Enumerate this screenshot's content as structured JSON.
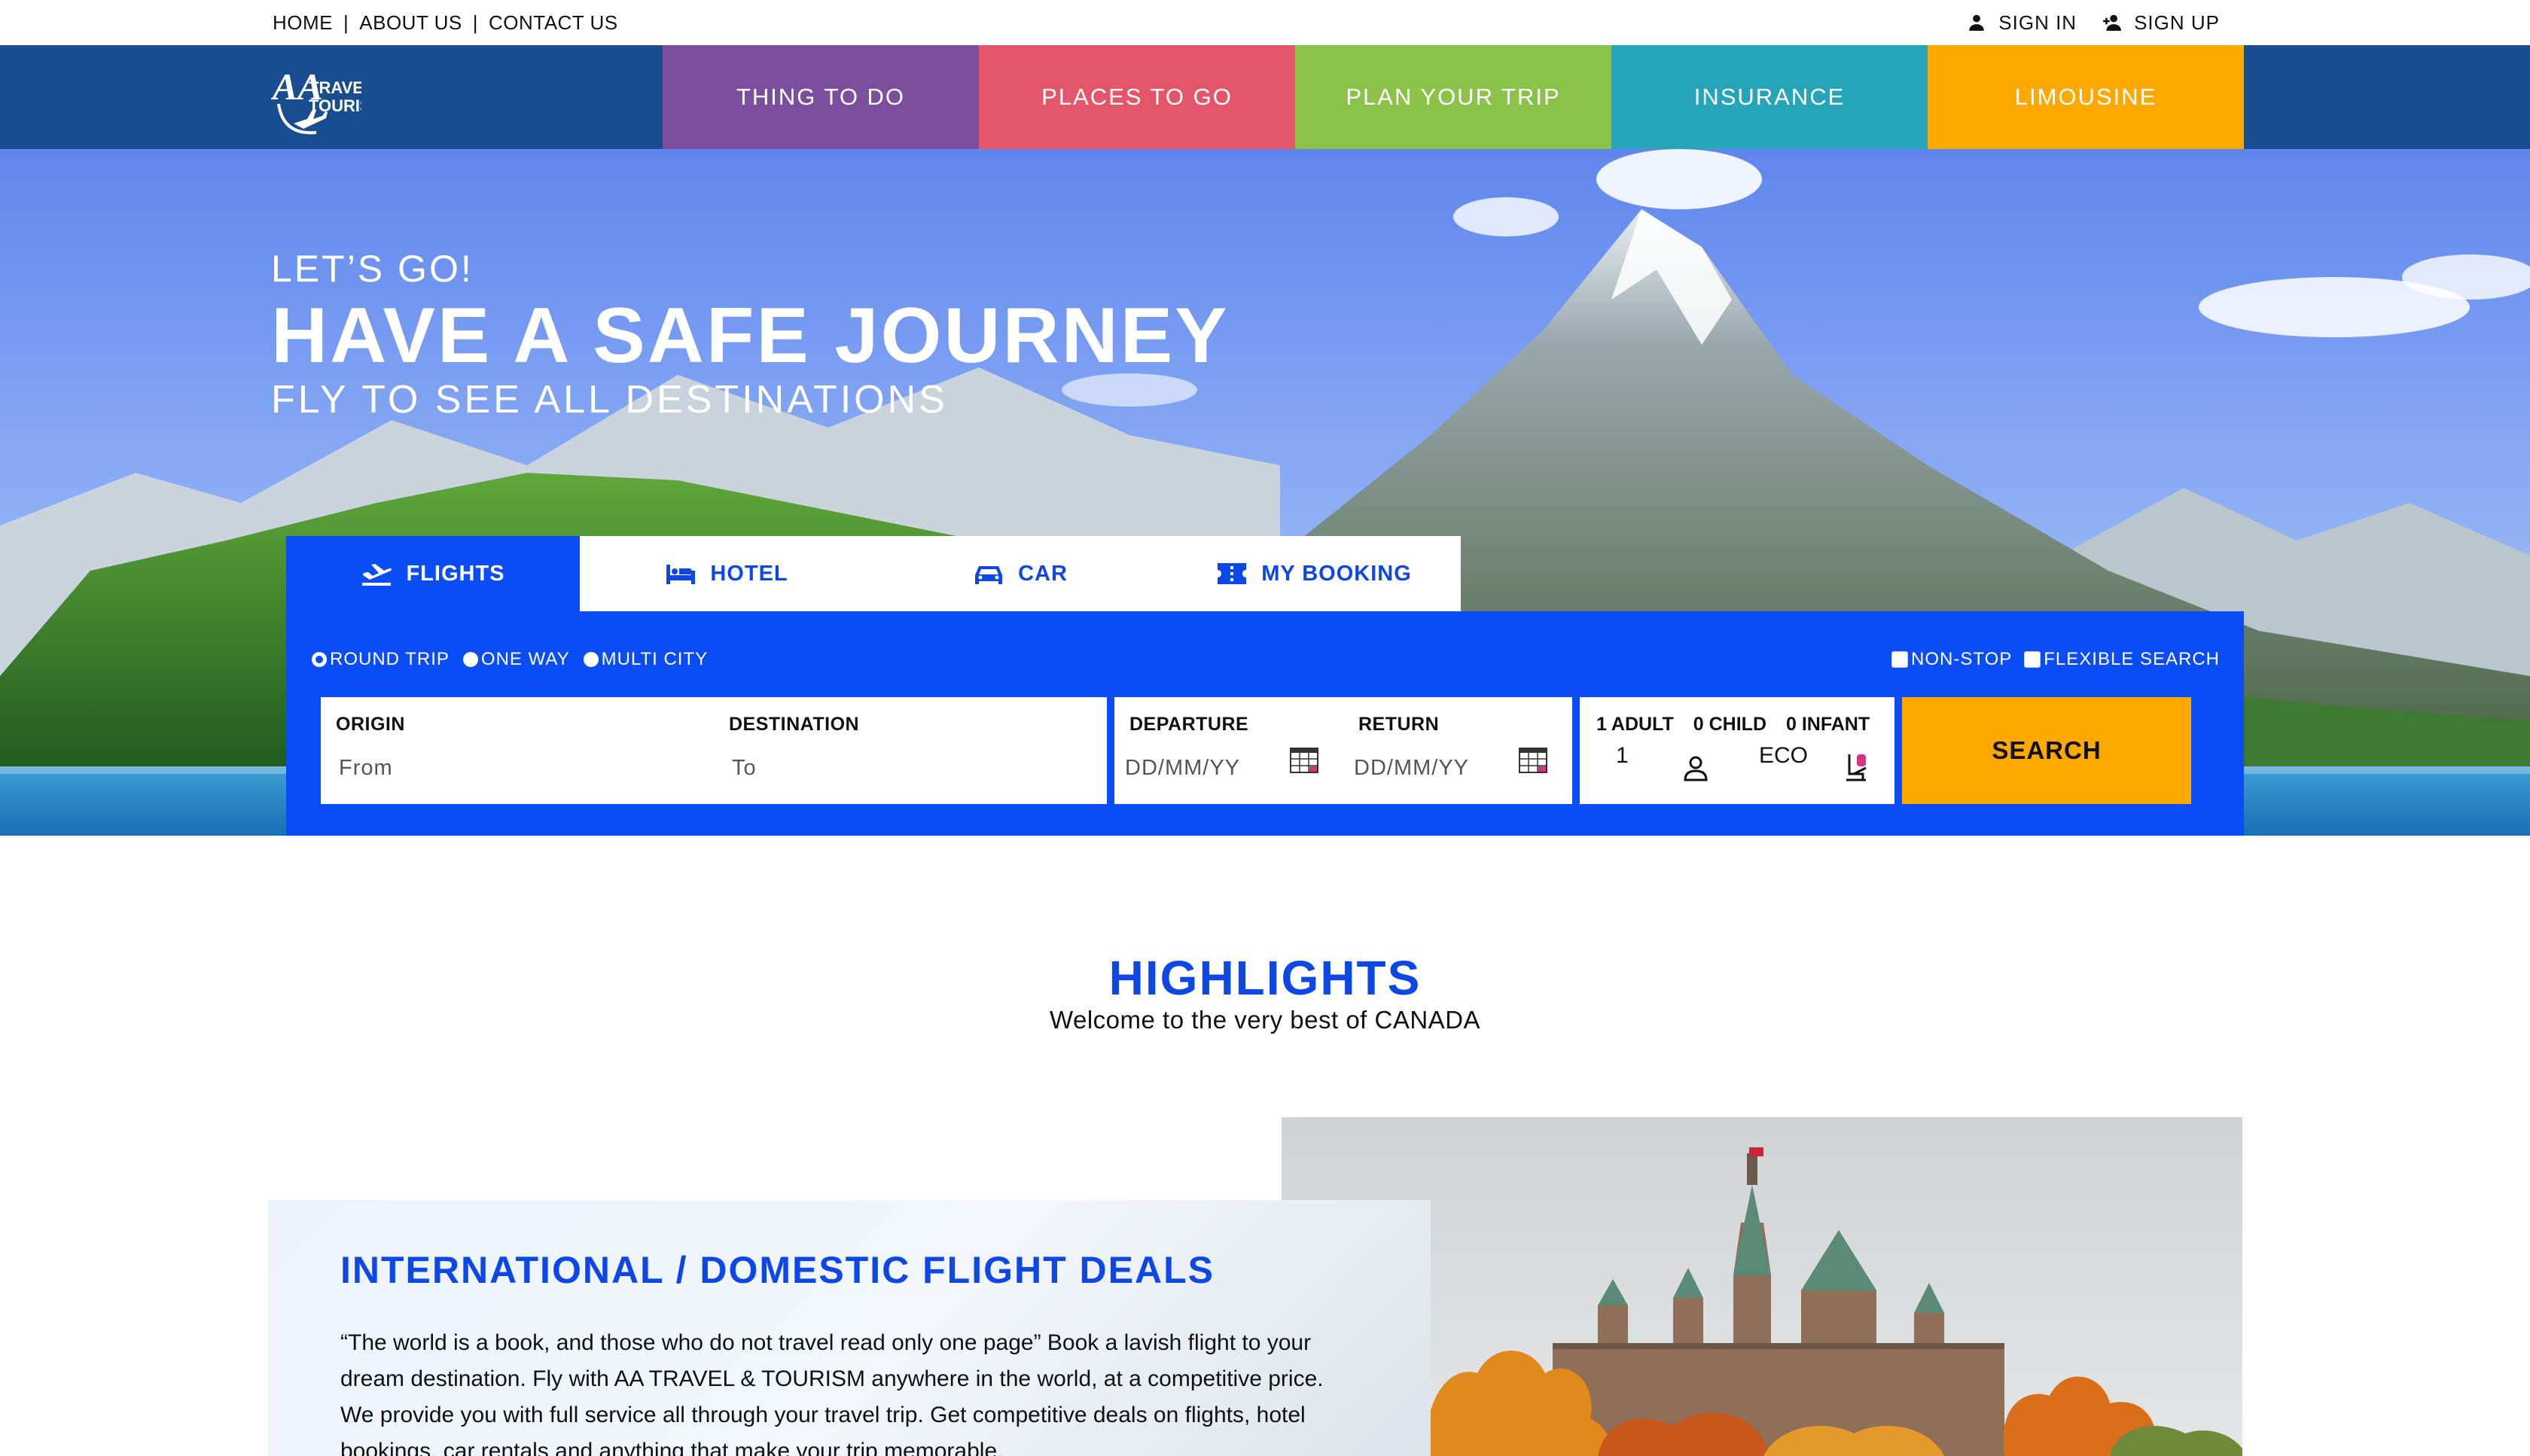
{
  "topnav": {
    "home": "HOME",
    "about": "ABOUT US",
    "contact": "CONTACT US",
    "separator": "|"
  },
  "account": {
    "sign_in": "SIGN IN",
    "sign_up": "SIGN UP"
  },
  "logo": {
    "line1": "TRAVEL &",
    "line2": "TOURISM",
    "mark": "AA"
  },
  "mainnav": [
    {
      "label": "THING TO DO",
      "color": "#7b4f9e"
    },
    {
      "label": "PLACES TO GO",
      "color": "#e3566a"
    },
    {
      "label": "PLAN YOUR TRIP",
      "color": "#8bc34a"
    },
    {
      "label": "INSURANCE",
      "color": "#26a5b8"
    },
    {
      "label": "LIMOUSINE",
      "color": "#ffa800"
    }
  ],
  "hero": {
    "kicker": "LET’S GO!",
    "title": "HAVE A SAFE JOURNEY",
    "subtitle": "FLY TO SEE ALL DESTINATIONS"
  },
  "booking": {
    "tabs": [
      {
        "label": "FLIGHTS",
        "icon": "plane-departure-icon",
        "active": true
      },
      {
        "label": "HOTEL",
        "icon": "bed-icon",
        "active": false
      },
      {
        "label": "CAR",
        "icon": "car-icon",
        "active": false
      },
      {
        "label": "MY BOOKING",
        "icon": "ticket-icon",
        "active": false
      }
    ],
    "trip_types": [
      "ROUND TRIP",
      "ONE WAY",
      "MULTI CITY"
    ],
    "selected_trip_type": "ROUND TRIP",
    "filters": [
      "NON-STOP",
      "FLEXIBLE SEARCH"
    ],
    "origin": {
      "label": "ORIGIN",
      "placeholder": "From"
    },
    "destination": {
      "label": "DESTINATION",
      "placeholder": "To"
    },
    "departure": {
      "label": "DEPARTURE",
      "placeholder": "DD/MM/YY"
    },
    "return": {
      "label": "RETURN",
      "placeholder": "DD/MM/YY"
    },
    "passengers": {
      "adult_label": "1 ADULT",
      "child_label": "0 CHILD",
      "infant_label": "0 INFANT",
      "count": "1",
      "cabin": "ECO"
    },
    "search_label": "SEARCH",
    "accent_color": "#0a4cf5",
    "search_color": "#ffa800"
  },
  "highlights": {
    "title": "HIGHLIGHTS",
    "subtitle": "Welcome to the very best of CANADA"
  },
  "deal": {
    "title": "INTERNATIONAL / DOMESTIC FLIGHT DEALS",
    "text_before": "“The world is a book, and those who do not travel read only one page” Book a lavish flight to your dream destination. Fly with ",
    "brand": "AA TRAVEL & TOURISM",
    "text_after": " anywhere in the world, at a competitive price. We provide you with full service all through your travel trip. Get competitive deals on flights, hotel bookings, car rentals and anything that make your trip memorable."
  }
}
